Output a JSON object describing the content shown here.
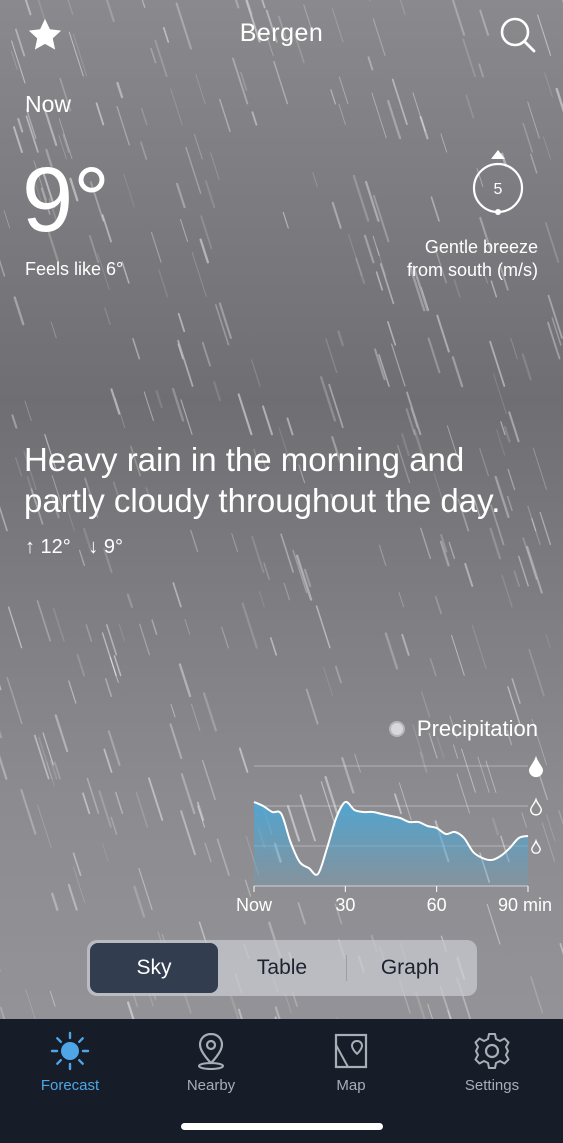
{
  "header": {
    "city": "Bergen",
    "favorite_icon": "star-icon",
    "search_icon": "search-icon"
  },
  "current": {
    "label": "Now",
    "temperature": "9°",
    "feels_like": "Feels like 6°",
    "wind_speed": "5",
    "wind_line1": "Gentle breeze",
    "wind_line2": "from south (m/s)"
  },
  "summary": {
    "text": "Heavy rain in the morning and partly cloudy throughout the day.",
    "high": "↑ 12°",
    "low": "↓ 9°"
  },
  "chart_data": {
    "type": "area",
    "title": "",
    "legend": "Precipitation",
    "x_ticks": [
      "Now",
      "30",
      "60",
      "90 min"
    ],
    "xlim": [
      0,
      90
    ],
    "ylim": [
      0,
      3
    ],
    "y_tick_icons": [
      "droplet-light",
      "droplet-medium",
      "droplet-heavy"
    ],
    "colors": {
      "fill": "#4fa6d3",
      "line": "#ffffff"
    },
    "series": [
      {
        "x": [
          0,
          3,
          6,
          9,
          12,
          15,
          18,
          21,
          24,
          27,
          30,
          33,
          36,
          39,
          42,
          45,
          48,
          51,
          54,
          57,
          60,
          63,
          66,
          69,
          72,
          75,
          78,
          81,
          84,
          87,
          90
        ],
        "values": [
          2.1,
          2.0,
          1.85,
          1.8,
          1.1,
          0.6,
          0.45,
          0.3,
          0.95,
          1.7,
          2.1,
          1.9,
          1.85,
          1.85,
          1.8,
          1.75,
          1.7,
          1.6,
          1.6,
          1.5,
          1.45,
          1.3,
          1.35,
          1.2,
          0.85,
          0.7,
          0.65,
          0.75,
          0.95,
          1.2,
          1.25
        ]
      }
    ]
  },
  "view_switch": {
    "options": [
      "Sky",
      "Table",
      "Graph"
    ],
    "selected": "Sky"
  },
  "tabbar": {
    "items": [
      {
        "label": "Forecast",
        "icon": "sun-icon",
        "active": true
      },
      {
        "label": "Nearby",
        "icon": "location-pin-icon",
        "active": false
      },
      {
        "label": "Map",
        "icon": "map-icon",
        "active": false
      },
      {
        "label": "Settings",
        "icon": "gear-icon",
        "active": false
      }
    ],
    "active_color": "#4ea6e6"
  }
}
